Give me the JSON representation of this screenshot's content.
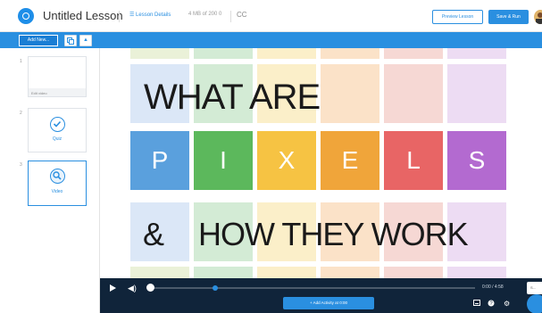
{
  "header": {
    "title": "Untitled Lesson",
    "lesson_details": "☰ Lesson Details",
    "file_info": "4 MB of 200 0",
    "preview_label": "Preview Lesson",
    "save_label": "Save & Run"
  },
  "sidebar": {
    "add_new_label": "Add New...",
    "slides": [
      {
        "number": "1",
        "label": "Edit video",
        "type": "video-thumbnail"
      },
      {
        "number": "2",
        "label": "Quiz",
        "type": "quiz",
        "icon": "check-circle-icon"
      },
      {
        "number": "3",
        "label": "Video",
        "type": "video",
        "icon": "video-search-icon"
      }
    ]
  },
  "slide_content": {
    "line1": "WHAT ARE",
    "letters": [
      "P",
      "I",
      "X",
      "E",
      "L",
      "S"
    ],
    "line3_prefix": "&",
    "line3": "HOW THEY WORK",
    "colors": {
      "green": "#5cb85c",
      "blue": "#5aa0dd",
      "yellow": "#f6c343",
      "orange": "#f0a53a",
      "red": "#e86565",
      "purple": "#b36ad0",
      "light_tiles": [
        "#eaf1d8",
        "#d3ebd5",
        "#fbefc9",
        "#fbe2c8",
        "#f6d8d4",
        "#eddcf3",
        "#dbe7f7"
      ]
    }
  },
  "player": {
    "time": "0:00 / 4:58",
    "progress": 0.0,
    "marker_position_fraction": 0.2,
    "add_activity_label": "+ Add Activity at 0:00",
    "side_button_label": "S..."
  }
}
